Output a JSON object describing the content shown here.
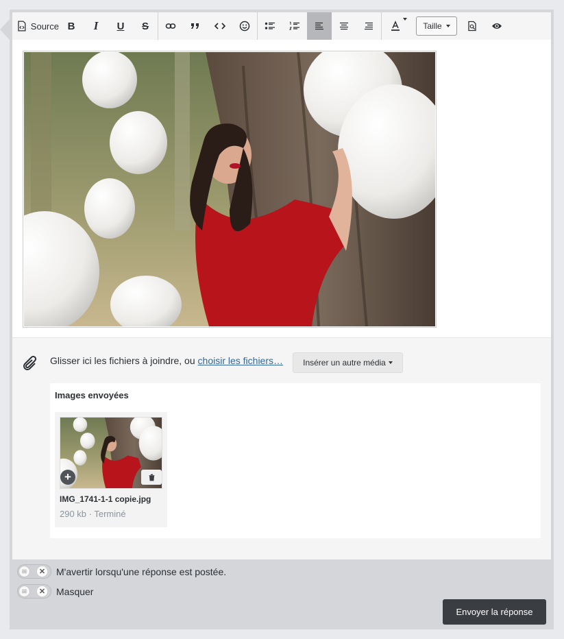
{
  "toolbar": {
    "source_label": "Source",
    "bold_label": "B",
    "italic_label": "I",
    "underline_label": "U",
    "strike_label": "S",
    "size_label": "Taille"
  },
  "attachments": {
    "drop_text": "Glisser ici les fichiers à joindre, ou ",
    "choose_link": "choisir les fichiers…",
    "insert_media_label": "Insérer un autre média"
  },
  "uploads": {
    "title": "Images envoyées",
    "files": [
      {
        "name": "IMG_1741-1-1 copie.jpg",
        "meta": "290 kb · Terminé"
      }
    ]
  },
  "options": {
    "notify_label": "M'avertir lorsqu'une réponse est postée.",
    "hide_label": "Masquer"
  },
  "actions": {
    "send_label": "Envoyer la réponse"
  },
  "colors": {
    "accent_link": "#336699",
    "button_dark": "#3a3d42",
    "active_tool": "#b6b7ba"
  }
}
